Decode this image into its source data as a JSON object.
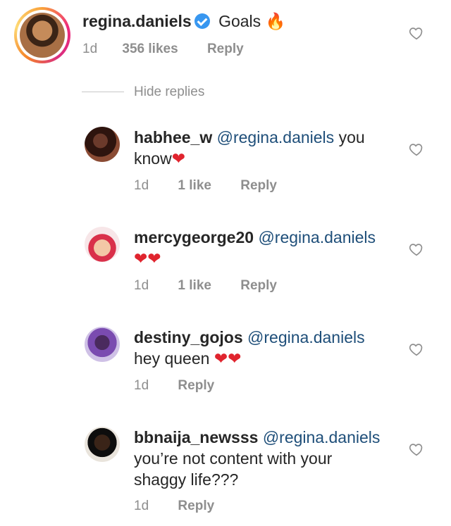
{
  "parent_comment": {
    "username": "regina.daniels",
    "text": "Goals",
    "emoji": "🔥",
    "time": "1d",
    "likes": "356 likes",
    "reply_label": "Reply"
  },
  "hide_replies_label": "Hide replies",
  "replies": [
    {
      "username": "habhee_w",
      "mention": "@regina.daniels",
      "text": "you",
      "text2": "know",
      "hearts": "❤",
      "time": "1d",
      "likes": "1 like",
      "reply_label": "Reply"
    },
    {
      "username": "mercygeorge20",
      "mention": "@regina.daniels",
      "hearts": "❤❤",
      "time": "1d",
      "likes": "1 like",
      "reply_label": "Reply"
    },
    {
      "username": "destiny_gojos",
      "mention": "@regina.daniels",
      "text": "hey queen",
      "hearts": "❤❤",
      "time": "1d",
      "reply_label": "Reply"
    },
    {
      "username": "bbnaija_newsss",
      "mention": "@regina.daniels",
      "text": "you’re not content with your",
      "text2": "shaggy life???",
      "time": "1d",
      "reply_label": "Reply"
    }
  ],
  "colors": {
    "mention": "#1e4e79",
    "meta": "#8e8e8e",
    "heart": "#e0242e",
    "verified": "#3897f0"
  },
  "icons": {
    "like": "heart-outline-icon",
    "verified": "verified-badge-icon"
  }
}
